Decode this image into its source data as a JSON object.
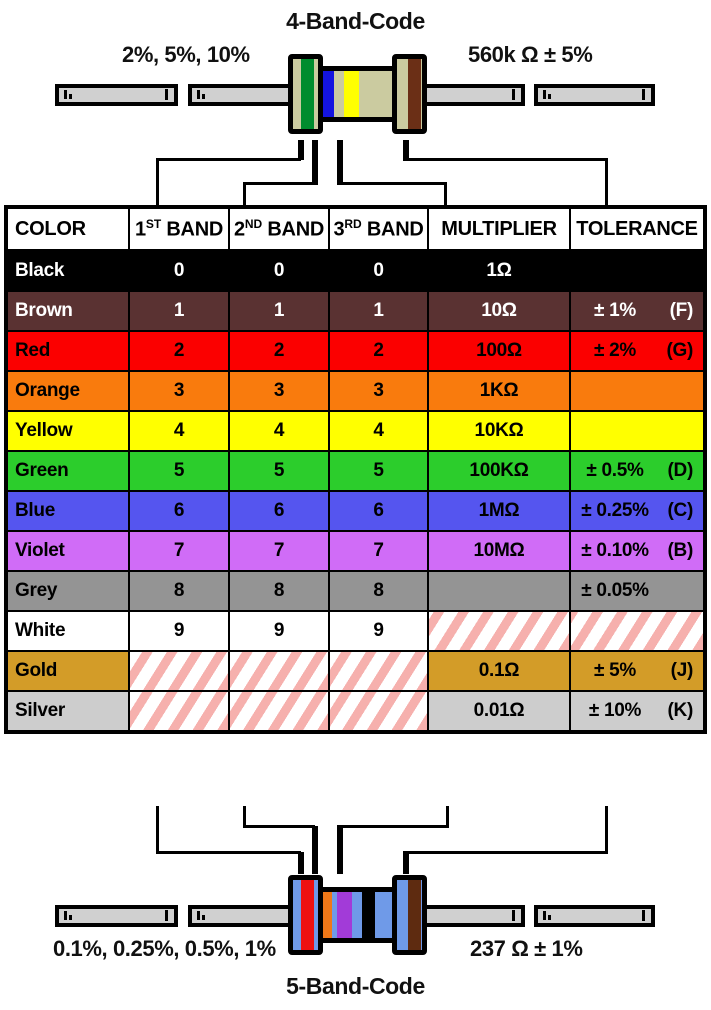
{
  "top_diagram": {
    "title": "4-Band-Code",
    "left_label": "2%, 5%, 10%",
    "right_label": "560k Ω  ± 5%",
    "body_color": "#cbcba0",
    "bands": [
      {
        "name": "green-band",
        "color": "#008c2e"
      },
      {
        "name": "blue-band",
        "color": "#1414e0"
      },
      {
        "name": "yellow-band",
        "color": "#ffff00"
      },
      {
        "name": "brown-band",
        "color": "#6b2f16"
      }
    ]
  },
  "bottom_diagram": {
    "title": "5-Band-Code",
    "left_label": "0.1%, 0.25%, 0.5%, 1%",
    "right_label": "237 Ω  ± 1%",
    "body_color": "#6f9ae8",
    "bands": [
      {
        "name": "red-band",
        "color": "#ee1111"
      },
      {
        "name": "orange-band",
        "color": "#f07818"
      },
      {
        "name": "violet-band",
        "color": "#a23bd8"
      },
      {
        "name": "black-band",
        "color": "#000000"
      },
      {
        "name": "brown-band",
        "color": "#5e2b10"
      }
    ]
  },
  "table": {
    "headers": [
      {
        "label": "COLOR",
        "sup": ""
      },
      {
        "label": " BAND",
        "sup": "1ST",
        "prefix": "1",
        "supText": "ST"
      },
      {
        "label": " BAND",
        "sup": "2ND",
        "prefix": "2",
        "supText": "ND"
      },
      {
        "label": " BAND",
        "sup": "3RD",
        "prefix": "3",
        "supText": "RD"
      },
      {
        "label": "MULTIPLIER",
        "sup": ""
      },
      {
        "label": "TOLERANCE",
        "sup": ""
      }
    ],
    "rows": [
      {
        "color": "Black",
        "bg": "#000000",
        "fg": "#ffffff",
        "band1": "0",
        "band2": "0",
        "band3": "0",
        "multiplier": "1Ω",
        "tolerance": "",
        "tol_code": "",
        "na": []
      },
      {
        "color": "Brown",
        "bg": "#5a3232",
        "fg": "#ffffff",
        "band1": "1",
        "band2": "1",
        "band3": "1",
        "multiplier": "10Ω",
        "tolerance": "± 1%",
        "tol_code": "(F)",
        "na": []
      },
      {
        "color": "Red",
        "bg": "#fb0000",
        "fg": "#000000",
        "band1": "2",
        "band2": "2",
        "band3": "2",
        "multiplier": "100Ω",
        "tolerance": "± 2%",
        "tol_code": "(G)",
        "na": []
      },
      {
        "color": "Orange",
        "bg": "#f97b0d",
        "fg": "#000000",
        "band1": "3",
        "band2": "3",
        "band3": "3",
        "multiplier": "1KΩ",
        "tolerance": "",
        "tol_code": "",
        "na": []
      },
      {
        "color": "Yellow",
        "bg": "#ffff00",
        "fg": "#000000",
        "band1": "4",
        "band2": "4",
        "band3": "4",
        "multiplier": "10KΩ",
        "tolerance": "",
        "tol_code": "",
        "na": []
      },
      {
        "color": "Green",
        "bg": "#2ccd2c",
        "fg": "#000000",
        "band1": "5",
        "band2": "5",
        "band3": "5",
        "multiplier": "100KΩ",
        "tolerance": "± 0.5%",
        "tol_code": "(D)",
        "na": []
      },
      {
        "color": "Blue",
        "bg": "#5555ef",
        "fg": "#000000",
        "band1": "6",
        "band2": "6",
        "band3": "6",
        "multiplier": "1MΩ",
        "tolerance": "± 0.25%",
        "tol_code": "(C)",
        "na": []
      },
      {
        "color": "Violet",
        "bg": "#d06cf7",
        "fg": "#000000",
        "band1": "7",
        "band2": "7",
        "band3": "7",
        "multiplier": "10MΩ",
        "tolerance": "± 0.10%",
        "tol_code": "(B)",
        "na": []
      },
      {
        "color": "Grey",
        "bg": "#949494",
        "fg": "#000000",
        "band1": "8",
        "band2": "8",
        "band3": "8",
        "multiplier": "",
        "tolerance": "± 0.05%",
        "tol_code": "",
        "na": []
      },
      {
        "color": "White",
        "bg": "#ffffff",
        "fg": "#000000",
        "band1": "9",
        "band2": "9",
        "band3": "9",
        "multiplier": "",
        "tolerance": "",
        "tol_code": "",
        "na": [
          "multiplier",
          "tolerance"
        ]
      },
      {
        "color": "Gold",
        "bg": "#d39c28",
        "fg": "#000000",
        "band1": "",
        "band2": "",
        "band3": "",
        "multiplier": "0.1Ω",
        "tolerance": "± 5%",
        "tol_code": "(J)",
        "na": [
          "band1",
          "band2",
          "band3"
        ]
      },
      {
        "color": "Silver",
        "bg": "#cdcdcd",
        "fg": "#000000",
        "band1": "",
        "band2": "",
        "band3": "",
        "multiplier": "0.01Ω",
        "tolerance": "± 10%",
        "tol_code": "(K)",
        "na": [
          "band1",
          "band2",
          "band3"
        ]
      }
    ]
  }
}
